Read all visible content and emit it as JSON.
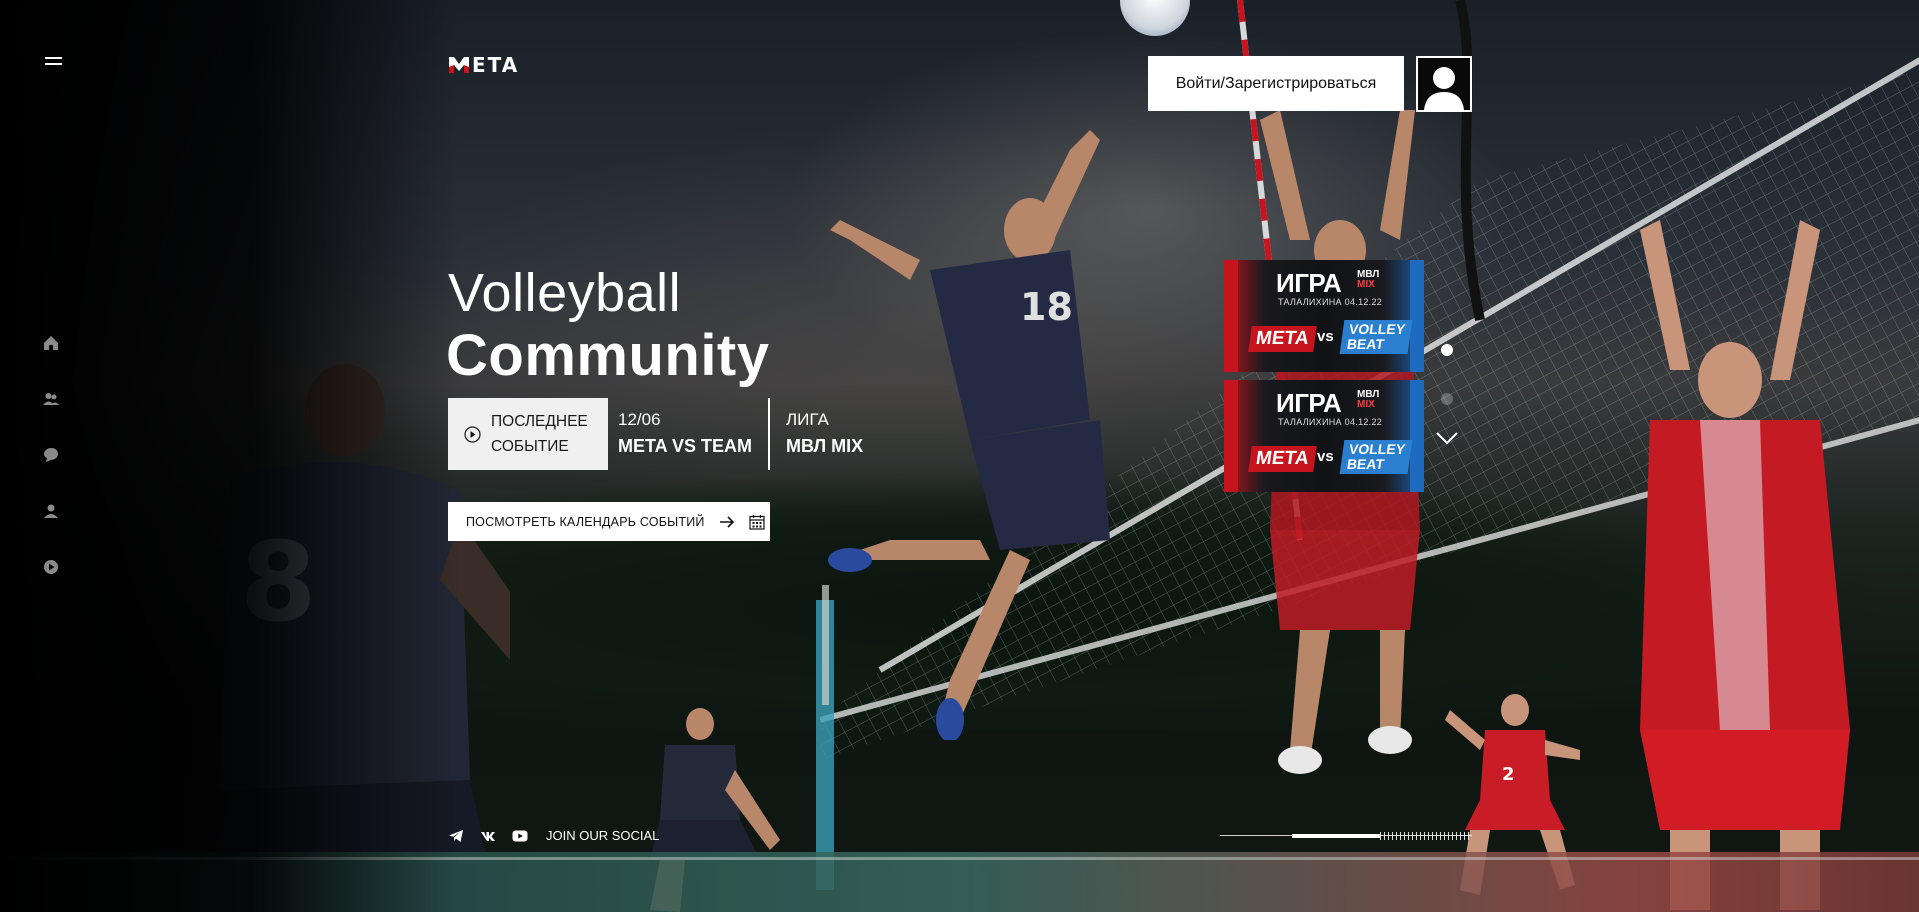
{
  "brand": {
    "logo_text": "ETA"
  },
  "header": {
    "login_label": "Войти/Зарегистрироваться"
  },
  "hero": {
    "title_light": "Volleyball",
    "title_bold": "Community"
  },
  "last_event": {
    "button_label_line1": "ПОСЛЕДНЕЕ",
    "button_label_line2": "СОБЫТИЕ",
    "date": "12/06",
    "match": "META VS TEAM",
    "league_label": "ЛИГА",
    "league_value": "МВЛ MIX"
  },
  "calendar_button_label": "ПОСМОТРЕТЬ КАЛЕНДАРЬ СОБЫТИЙ",
  "event_cards": [
    {
      "title": "ИГРА",
      "tag_top": "МВЛ",
      "tag_bottom": "MIX",
      "subtitle": "ТАЛАЛИХИНА 04.12.22",
      "team1": "МЕТА",
      "vs": "vs",
      "team2_line1": "VOLLEY",
      "team2_line2": "BEAT"
    },
    {
      "title": "ИГРА",
      "tag_top": "МВЛ",
      "tag_bottom": "MIX",
      "subtitle": "ТАЛАЛИХИНА 04.12.22",
      "team1": "МЕТА",
      "vs": "vs",
      "team2_line1": "VOLLEY",
      "team2_line2": "BEAT"
    }
  ],
  "slider": {
    "active_index": 0,
    "count": 2
  },
  "social": {
    "join_label": "JOIN OUR SOCIAL",
    "icons": [
      "telegram-icon",
      "vk-icon",
      "youtube-icon"
    ]
  },
  "sidebar": {
    "icons": [
      "home-icon",
      "users-icon",
      "chat-icon",
      "user-icon",
      "play-icon"
    ]
  },
  "progress": {
    "fraction": 0.63
  },
  "colors": {
    "brand_red": "#c8141e",
    "accent_blue": "#1e6ac0",
    "text_white": "#ffffff",
    "button_bg": "#ffffff"
  }
}
